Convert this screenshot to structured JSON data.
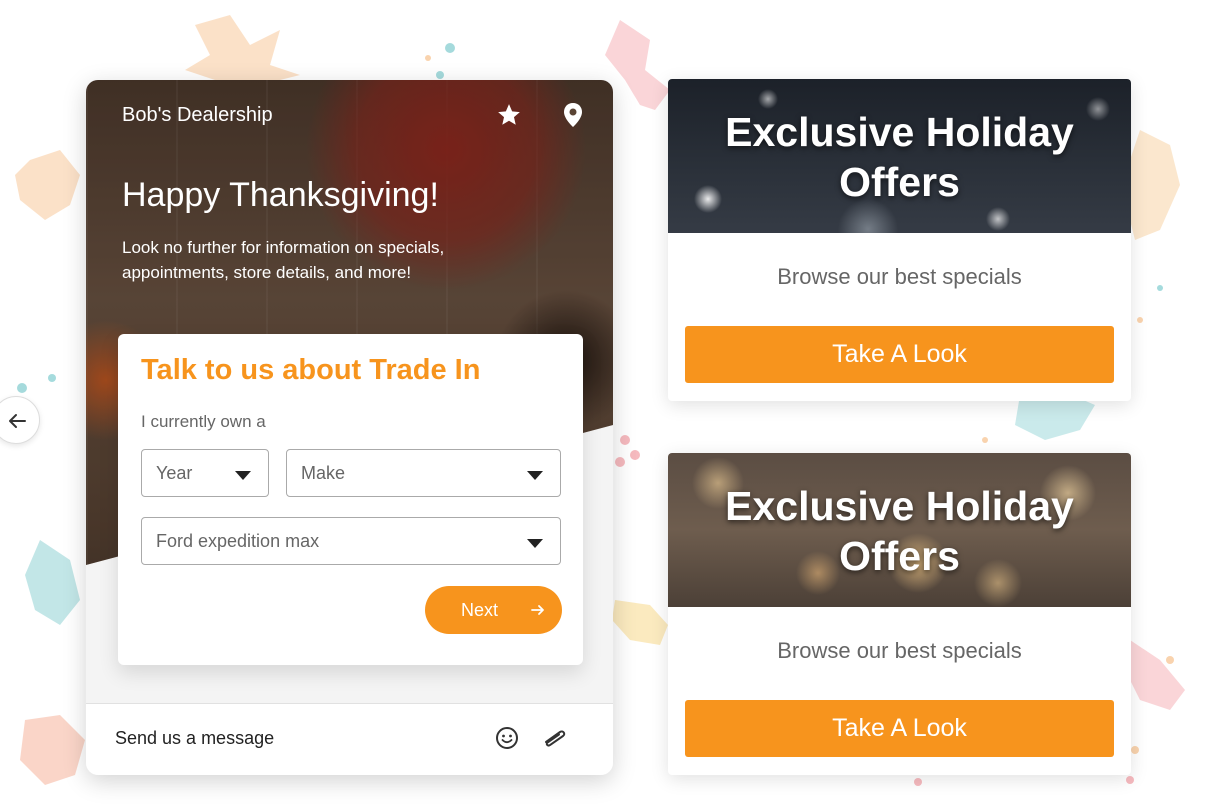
{
  "widget": {
    "brand": "Bob's Dealership",
    "hero_heading": "Happy Thanksgiving!",
    "hero_sub": "Look no further for information on specials, appointments, store details, and more!",
    "header_icons": [
      "star-icon",
      "location-pin-icon"
    ],
    "form": {
      "title": "Talk to us about Trade In",
      "label": "I currently own a",
      "year_select": "Year",
      "make_select": "Make",
      "model_select": "Ford expedition max",
      "next_label": "Next"
    },
    "message": {
      "placeholder": "Send us a message",
      "icons": [
        "emoji-icon",
        "paperclip-icon"
      ]
    },
    "back_icon": "arrow-left-icon"
  },
  "promos": [
    {
      "heading_line1": "Exclusive Holiday",
      "heading_line2": "Offers",
      "subtitle": "Browse our best specials",
      "button": "Take A Look"
    },
    {
      "heading_line1": "Exclusive Holiday",
      "heading_line2": "Offers",
      "subtitle": "Browse our best specials",
      "button": "Take A Look"
    }
  ],
  "colors": {
    "accent": "#f7941d",
    "white": "#ffffff",
    "text_muted": "#666666"
  }
}
